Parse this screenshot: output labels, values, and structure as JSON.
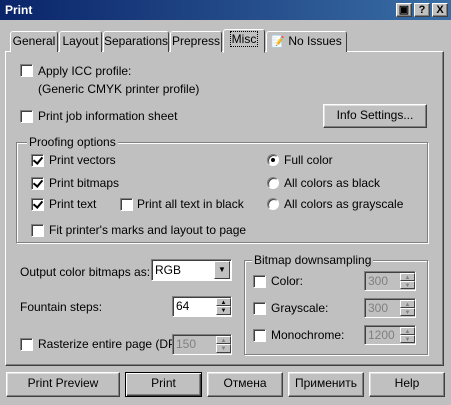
{
  "window": {
    "title": "Print"
  },
  "title_buttons": {
    "help_glyph": "?",
    "close_glyph": "X"
  },
  "tabs": [
    {
      "label": "General"
    },
    {
      "label": "Layout"
    },
    {
      "label": "Separations"
    },
    {
      "label": "Prepress"
    },
    {
      "label": "Misc"
    },
    {
      "label": "No Issues"
    }
  ],
  "misc": {
    "apply_icc_label": "Apply ICC profile:",
    "icc_profile_name": "(Generic CMYK printer profile)",
    "print_job_info_label": "Print job information sheet",
    "info_settings_button": "Info Settings...",
    "proofing": {
      "title": "Proofing options",
      "print_vectors": "Print vectors",
      "print_bitmaps": "Print bitmaps",
      "print_text": "Print text",
      "print_all_text_black": "Print all text in black",
      "full_color": "Full color",
      "all_colors_black": "All colors as black",
      "all_colors_grayscale": "All colors as grayscale",
      "fit_marks": "Fit printer's marks and layout to page"
    },
    "output_color_label": "Output color bitmaps as:",
    "output_color_value": "RGB",
    "fountain_steps_label": "Fountain steps:",
    "fountain_steps_value": "64",
    "rasterize_label": "Rasterize entire page (DPI):",
    "rasterize_value": "150",
    "downsampling": {
      "title": "Bitmap downsampling",
      "color_label": "Color:",
      "color_value": "300",
      "grayscale_label": "Grayscale:",
      "grayscale_value": "300",
      "monochrome_label": "Monochrome:",
      "monochrome_value": "1200"
    }
  },
  "buttons": {
    "print_preview": "Print Preview",
    "print": "Print",
    "cancel": "Отмена",
    "apply": "Применить",
    "help": "Help"
  }
}
